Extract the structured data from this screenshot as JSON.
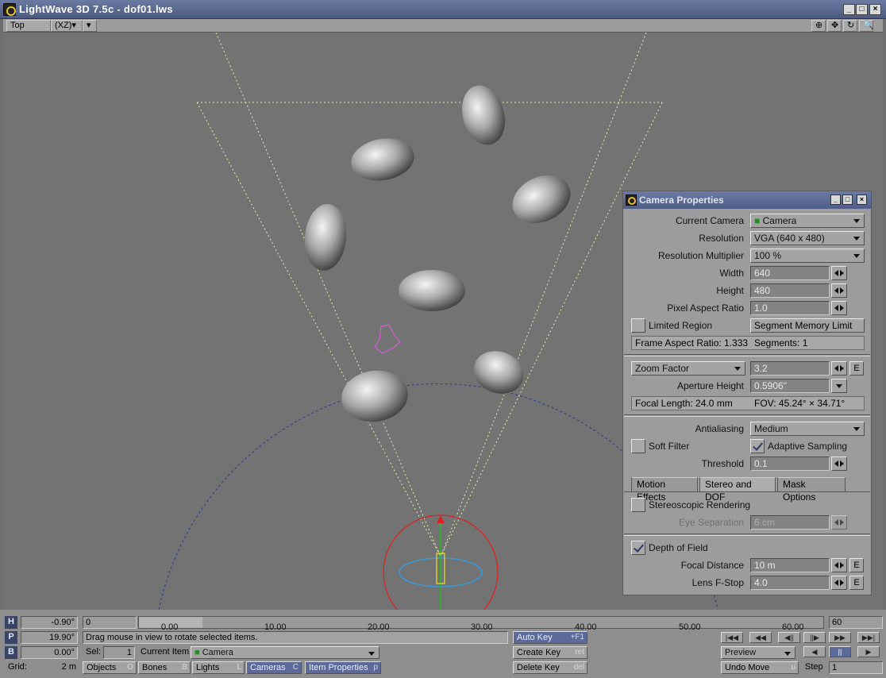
{
  "window": {
    "title": "LightWave 3D 7.5c - dof01.lws"
  },
  "viewport": {
    "view": "Top",
    "axes": "(XZ)"
  },
  "camera_panel": {
    "title": "Camera Properties",
    "current_camera_label": "Current Camera",
    "current_camera": "Camera",
    "resolution_label": "Resolution",
    "resolution": "VGA (640 x 480)",
    "res_mult_label": "Resolution Multiplier",
    "res_mult": "100 %",
    "width_label": "Width",
    "width": "640",
    "height_label": "Height",
    "height": "480",
    "pixel_aspect_label": "Pixel Aspect Ratio",
    "pixel_aspect": "1.0",
    "limited_region_label": "Limited Region",
    "segment_memory_label": "Segment Memory Limit",
    "frame_aspect": "Frame Aspect Ratio: 1.333",
    "segments": "Segments: 1",
    "zoom_type": "Zoom Factor",
    "zoom": "3.2",
    "aperture_label": "Aperture Height",
    "aperture": "0.5906\"",
    "focal_length": "Focal Length: 24.0 mm",
    "fov": "FOV: 45.24° × 34.71°",
    "antialiasing_label": "Antialiasing",
    "antialiasing": "Medium",
    "soft_filter_label": "Soft Filter",
    "adaptive_label": "Adaptive Sampling",
    "threshold_label": "Threshold",
    "threshold": "0.1",
    "tabs": [
      "Motion Effects",
      "Stereo and DOF",
      "Mask Options"
    ],
    "stereo_label": "Stereoscopic Rendering",
    "eye_sep_label": "Eye Separation",
    "eye_sep": "6 cm",
    "dof_label": "Depth of Field",
    "focal_dist_label": "Focal Distance",
    "focal_dist": "10 m",
    "fstop_label": "Lens F-Stop",
    "fstop": "4.0",
    "e_label": "E"
  },
  "timeline": {
    "h_label": "H",
    "h_value": "-0.90°",
    "p_label": "P",
    "p_value": "19.90°",
    "b_label": "B",
    "b_value": "0.00°",
    "start_frame": "0",
    "end_frame": "60",
    "ticks": [
      "0.00",
      "10.00",
      "20.00",
      "30.00",
      "40.00",
      "50.00",
      "60.00"
    ],
    "status": "Drag mouse in view to rotate selected items.",
    "sel_label": "Sel:",
    "sel_value": "1",
    "current_item_label": "Current Item",
    "current_item": "Camera",
    "grid_label": "Grid:",
    "grid_value": "2 m",
    "objects": "Objects",
    "objects_key": "O",
    "bones": "Bones",
    "bones_key": "B",
    "lights": "Lights",
    "lights_key": "L",
    "cameras": "Cameras",
    "cameras_key": "C",
    "item_props": "Item Properties",
    "item_props_key": "p",
    "auto_key": "Auto Key",
    "auto_key_sc": "+F1",
    "create_key": "Create Key",
    "create_key_sc": "ret",
    "delete_key": "Delete Key",
    "delete_key_sc": "del",
    "preview": "Preview",
    "undo": "Undo Move",
    "undo_sc": "u",
    "step_label": "Step",
    "step_value": "1"
  },
  "colors": {
    "accent": "#4f5d86",
    "viewport": "#737373",
    "panel": "#9c9c9c"
  }
}
